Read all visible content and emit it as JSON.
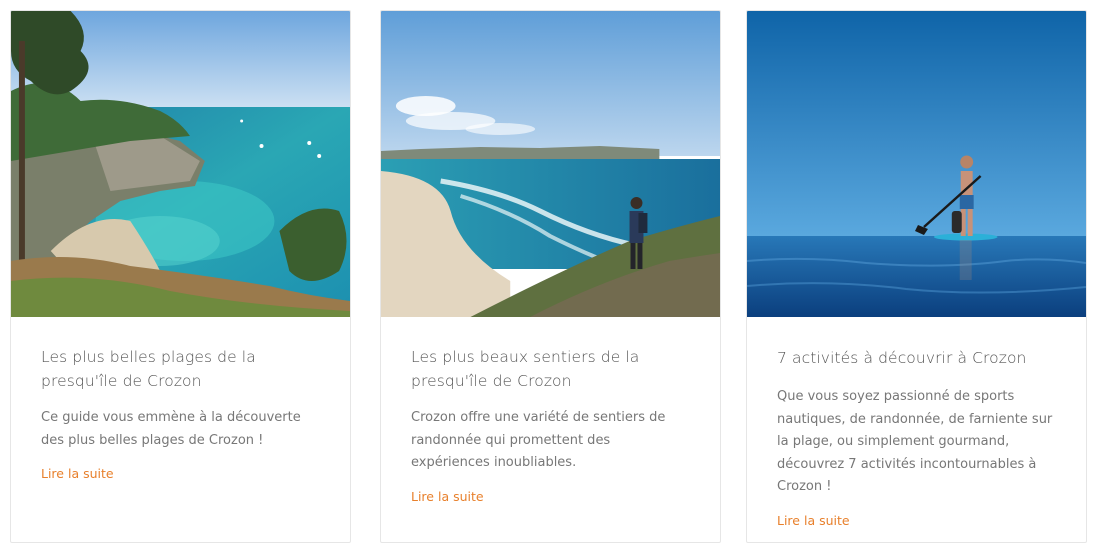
{
  "articles": [
    {
      "title": "Les plus belles plages de la presqu'île de Crozon",
      "excerpt": "Ce guide vous emmène à la découverte des plus belles plages de Crozon !",
      "link_label": "Lire la suite"
    },
    {
      "title": "Les plus beaux sentiers de la presqu'île de Crozon",
      "excerpt": "Crozon offre une variété de sentiers de randonnée qui promettent des expériences inoubliables.",
      "link_label": "Lire la suite"
    },
    {
      "title": "7 activités à découvrir à Crozon",
      "excerpt": "Que vous soyez passionné de sports nautiques, de randonnée, de farniente sur la plage, ou simplement gourmand, découvrez 7 activités incontournables à Crozon !",
      "link_label": "Lire la suite"
    }
  ],
  "colors": {
    "link": "#e8802c",
    "title": "#555555",
    "excerpt": "#777777",
    "card_border": "#e6e6e6"
  }
}
